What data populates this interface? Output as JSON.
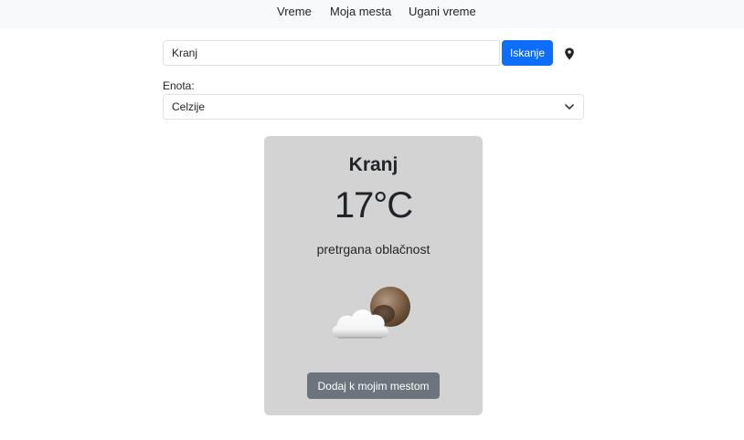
{
  "nav": {
    "items": [
      {
        "label": "Vreme"
      },
      {
        "label": "Moja mesta"
      },
      {
        "label": "Ugani vreme"
      }
    ]
  },
  "search": {
    "value": "Kranj",
    "button_label": "Iskanje",
    "location_icon": "map-marker-icon"
  },
  "units": {
    "label": "Enota:",
    "selected": "Celzije"
  },
  "weather": {
    "city": "Kranj",
    "temperature": "17°C",
    "description": "pretrgana oblačnost",
    "icon": "broken-clouds-icon",
    "add_button_label": "Dodaj k mojim mestom"
  },
  "colors": {
    "primary": "#0d6efd",
    "secondary": "#6c757d",
    "card_bg": "#d3d3d3",
    "nav_bg": "#f8f9fa"
  }
}
